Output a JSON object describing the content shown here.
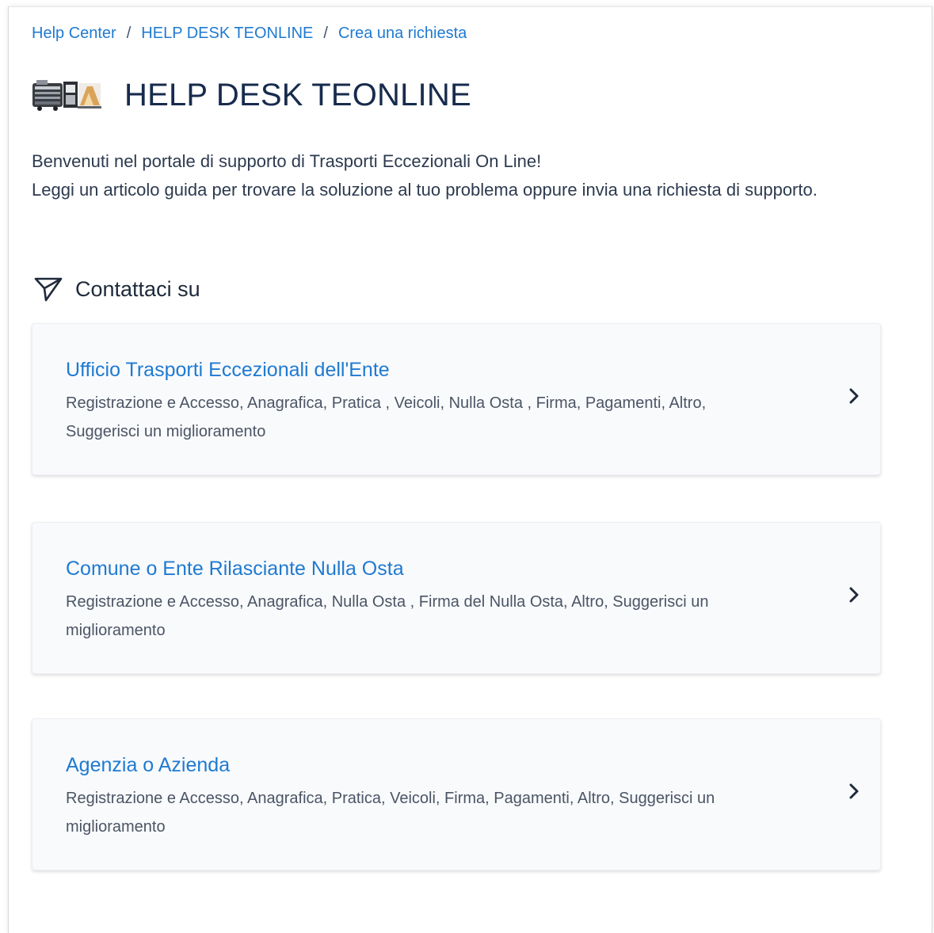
{
  "breadcrumb": {
    "items": [
      "Help Center",
      "HELP DESK TEONLINE",
      "Crea una richiesta"
    ],
    "separator": "/"
  },
  "header": {
    "title": "HELP DESK TEONLINE",
    "logo_icon": "truck-logo-icon"
  },
  "intro": {
    "line1": "Benvenuti nel portale di supporto di Trasporti Eccezionali On Line!",
    "line2": "Leggi un articolo guida per trovare la soluzione al tuo problema oppure invia una richiesta di supporto."
  },
  "section": {
    "title": "Contattaci su",
    "icon": "send-icon"
  },
  "cards": [
    {
      "title": "Ufficio Trasporti Eccezionali dell'Ente",
      "description": "Registrazione e Accesso, Anagrafica, Pratica , Veicoli, Nulla Osta , Firma, Pagamenti, Altro, Suggerisci un miglioramento"
    },
    {
      "title": "Comune o Ente Rilasciante Nulla Osta",
      "description": "Registrazione e Accesso, Anagrafica, Nulla Osta , Firma del Nulla Osta, Altro, Suggerisci un miglioramento"
    },
    {
      "title": "Agenzia o Azienda",
      "description": "Registrazione e Accesso, Anagrafica, Pratica, Veicoli, Firma, Pagamenti, Altro, Suggerisci un miglioramento"
    }
  ],
  "colors": {
    "link": "#1f7ad1",
    "title": "#172b4d",
    "body_text": "#2d3a4f",
    "card_bg": "#f9fafc"
  }
}
